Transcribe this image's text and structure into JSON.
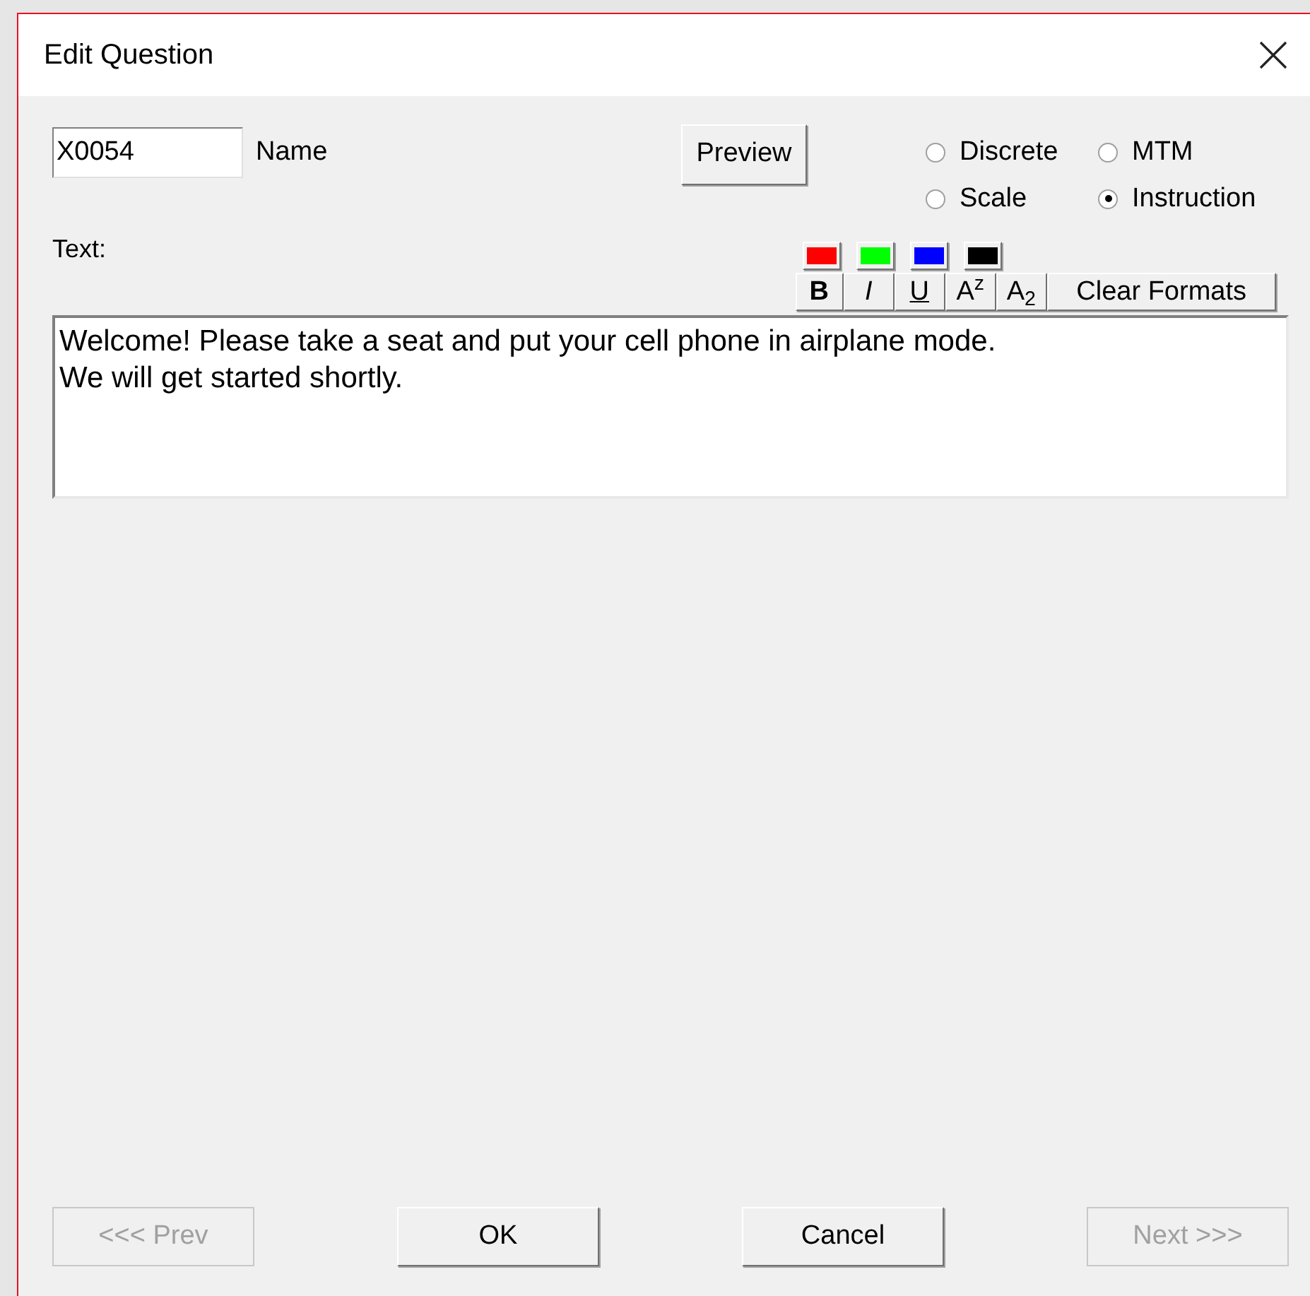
{
  "window": {
    "title": "Edit Question"
  },
  "name_field": {
    "value": "X0054",
    "label": "Name"
  },
  "preview_button": "Preview",
  "question_types": [
    {
      "label": "Discrete",
      "selected": false
    },
    {
      "label": "MTM",
      "selected": false
    },
    {
      "label": "Scale",
      "selected": false
    },
    {
      "label": "Instruction",
      "selected": true
    }
  ],
  "text_label": "Text:",
  "color_swatches": [
    {
      "color": "#ff0000"
    },
    {
      "color": "#00ff00"
    },
    {
      "color": "#0000ff"
    },
    {
      "color": "#000000"
    }
  ],
  "format_buttons": [
    {
      "kind": "bold",
      "label": "B"
    },
    {
      "kind": "italic",
      "label": "I"
    },
    {
      "kind": "underline",
      "label": "U"
    },
    {
      "kind": "superscript",
      "label": "A$^{z}$"
    },
    {
      "kind": "subscript",
      "label": "A$_{2}$"
    },
    {
      "kind": "text",
      "label": "Clear Formats"
    }
  ],
  "text_lines": [
    "Welcome! Please take a seat and put your cell phone in airplane mode.",
    "We will get started shortly."
  ],
  "buttons": [
    {
      "label": "<<< Prev",
      "disabled": true
    },
    {
      "label": "OK",
      "disabled": false
    },
    {
      "label": "Cancel",
      "disabled": false
    },
    {
      "label": "Next >>>",
      "disabled": true
    }
  ]
}
